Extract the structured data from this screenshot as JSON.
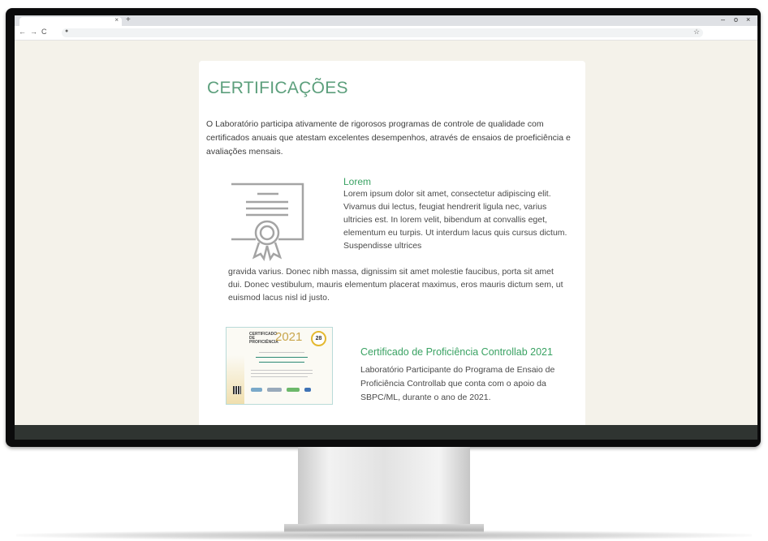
{
  "browser": {
    "tab_close": "×",
    "new_tab": "+",
    "nav_back": "←",
    "nav_forward": "→",
    "nav_reload": "C",
    "lock_icon": "●",
    "bookmark_star": "☆",
    "win_min": "–",
    "win_max": "o",
    "win_close": "×"
  },
  "page": {
    "heading": "CERTIFICAÇÕES",
    "intro": "O Laboratório participa ativamente de rigorosos programas de controle de qualidade com certificados anuais que atestam excelentes desempenhos, através de ensaios de proeficiência e avaliações mensais.",
    "sections": [
      {
        "title": "Lorem",
        "body": "Lorem ipsum dolor sit amet, consectetur adipiscing elit. Vivamus dui lectus, feugiat hendrerit ligula nec, varius ultricies est. In lorem velit, bibendum at convallis eget, elementum eu turpis. Ut interdum lacus quis cursus dictum. Suspendisse ultrices",
        "body_continued": "gravida varius. Donec nibh massa, dignissim sit amet molestie faucibus, porta sit amet dui. Donec vestibulum, mauris elementum placerat maximus, eros mauris dictum sem, ut euismod lacus nisl id justo."
      },
      {
        "title": "Certificado de Proficiência Controllab 2021",
        "body": "Laboratório Participante do Programa de Ensaio de Proficiência Controllab que conta com o apoio da SBPC/ML, durante o ano de 2021.",
        "thumbnail": {
          "title": "CERTIFICADO DE PROFICIÊNCIA",
          "year": "2021",
          "badge": "28"
        }
      }
    ]
  },
  "colors": {
    "heading": "#5c9f7c",
    "section_title": "#3aa263",
    "page_bg": "#f4f2ea",
    "card_bg": "#ffffff"
  }
}
